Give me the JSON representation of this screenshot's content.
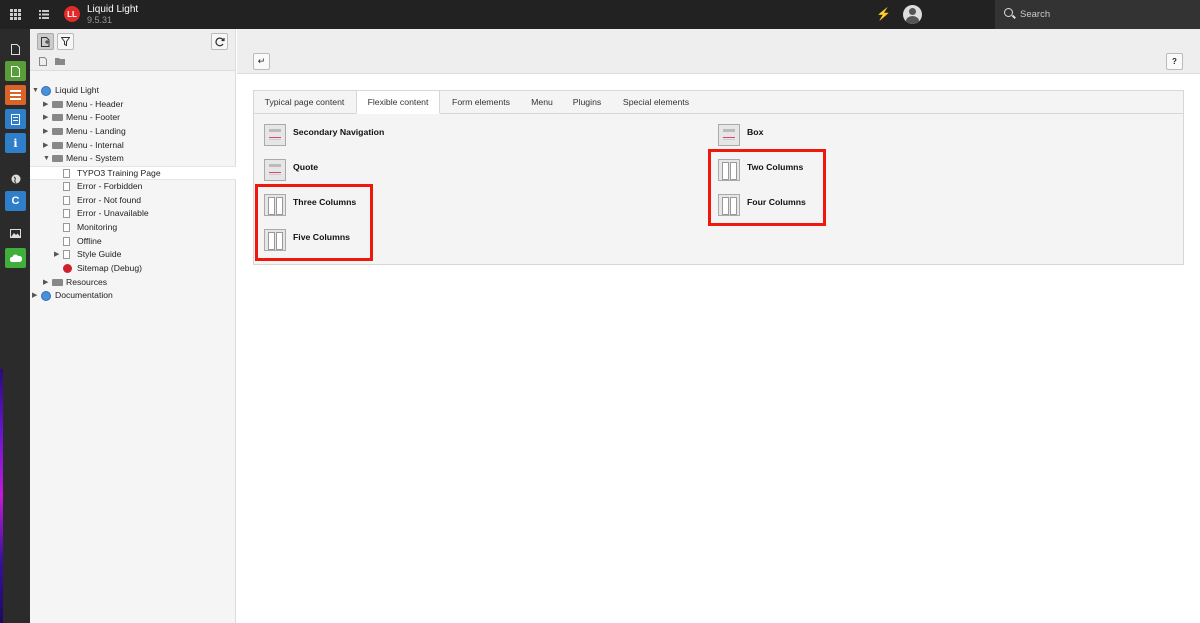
{
  "topbar": {
    "site_name": "Liquid Light",
    "site_version": "9.5.31",
    "logo_text": "LL",
    "search_label": "Search",
    "icons": [
      "apps-grid-icon",
      "module-list-icon",
      "flash-icon",
      "user-avatar-icon",
      "search-icon"
    ]
  },
  "modules": {
    "icons": [
      "page-module-icon",
      "view-module-icon",
      "list-module-icon",
      "info-module-icon",
      "template-module-icon",
      "globe-module-icon",
      "workspace-module-icon",
      "filelist-module-icon",
      "extension-module-icon"
    ],
    "colors": [
      "#5a9e3a",
      "#d9642a",
      "#2f7ec9",
      "#2f7ec9",
      "#2f7ec9",
      "#3fae3a"
    ]
  },
  "tree": {
    "toolbar_icons": [
      "new-page-icon",
      "filter-icon",
      "refresh-icon"
    ],
    "nodes": [
      {
        "label": "Liquid Light",
        "level": 0,
        "toggle": "▼",
        "icon": "site-root-icon"
      },
      {
        "label": "Menu - Header",
        "level": 1,
        "toggle": "▶",
        "icon": "folder-icon"
      },
      {
        "label": "Menu - Footer",
        "level": 1,
        "toggle": "▶",
        "icon": "folder-icon"
      },
      {
        "label": "Menu - Landing",
        "level": 1,
        "toggle": "▶",
        "icon": "folder-icon"
      },
      {
        "label": "Menu - Internal",
        "level": 1,
        "toggle": "▶",
        "icon": "folder-icon"
      },
      {
        "label": "Menu - System",
        "level": 1,
        "toggle": "▼",
        "icon": "folder-icon"
      },
      {
        "label": "TYPO3 Training Page",
        "level": 2,
        "toggle": "",
        "icon": "page-icon",
        "selected": true
      },
      {
        "label": "Error - Forbidden",
        "level": 2,
        "toggle": "",
        "icon": "page-icon"
      },
      {
        "label": "Error - Not found",
        "level": 2,
        "toggle": "",
        "icon": "page-icon"
      },
      {
        "label": "Error - Unavailable",
        "level": 2,
        "toggle": "",
        "icon": "page-icon"
      },
      {
        "label": "Monitoring",
        "level": 2,
        "toggle": "",
        "icon": "page-icon"
      },
      {
        "label": "Offline",
        "level": 2,
        "toggle": "",
        "icon": "page-icon"
      },
      {
        "label": "Style Guide",
        "level": 2,
        "toggle": "▶",
        "icon": "page-icon"
      },
      {
        "label": "Sitemap (Debug)",
        "level": 2,
        "toggle": "",
        "icon": "sitemap-icon"
      },
      {
        "label": "Resources",
        "level": 1,
        "toggle": "▶",
        "icon": "folder-icon"
      },
      {
        "label": "Documentation",
        "level": 0,
        "toggle": "▶",
        "icon": "site-root-icon"
      }
    ]
  },
  "docheader": {
    "back_label": "↵",
    "help_label": "?"
  },
  "wizard": {
    "tabs": [
      {
        "label": "Typical page content",
        "active": false
      },
      {
        "label": "Flexible content",
        "active": true
      },
      {
        "label": "Form elements",
        "active": false
      },
      {
        "label": "Menu",
        "active": false
      },
      {
        "label": "Plugins",
        "active": false
      },
      {
        "label": "Special elements",
        "active": false
      }
    ],
    "elements": [
      {
        "title": "Secondary Navigation",
        "icon": "text-element-icon"
      },
      {
        "title": "Quote",
        "icon": "text-element-icon"
      },
      {
        "title": "Three Columns",
        "icon": "columns-icon"
      },
      {
        "title": "Five Columns",
        "icon": "columns-icon"
      },
      {
        "title": "Box",
        "icon": "text-element-icon"
      },
      {
        "title": "Two Columns",
        "icon": "columns-icon"
      },
      {
        "title": "Four Columns",
        "icon": "columns-icon"
      }
    ],
    "highlight_color": "#f0180c"
  }
}
